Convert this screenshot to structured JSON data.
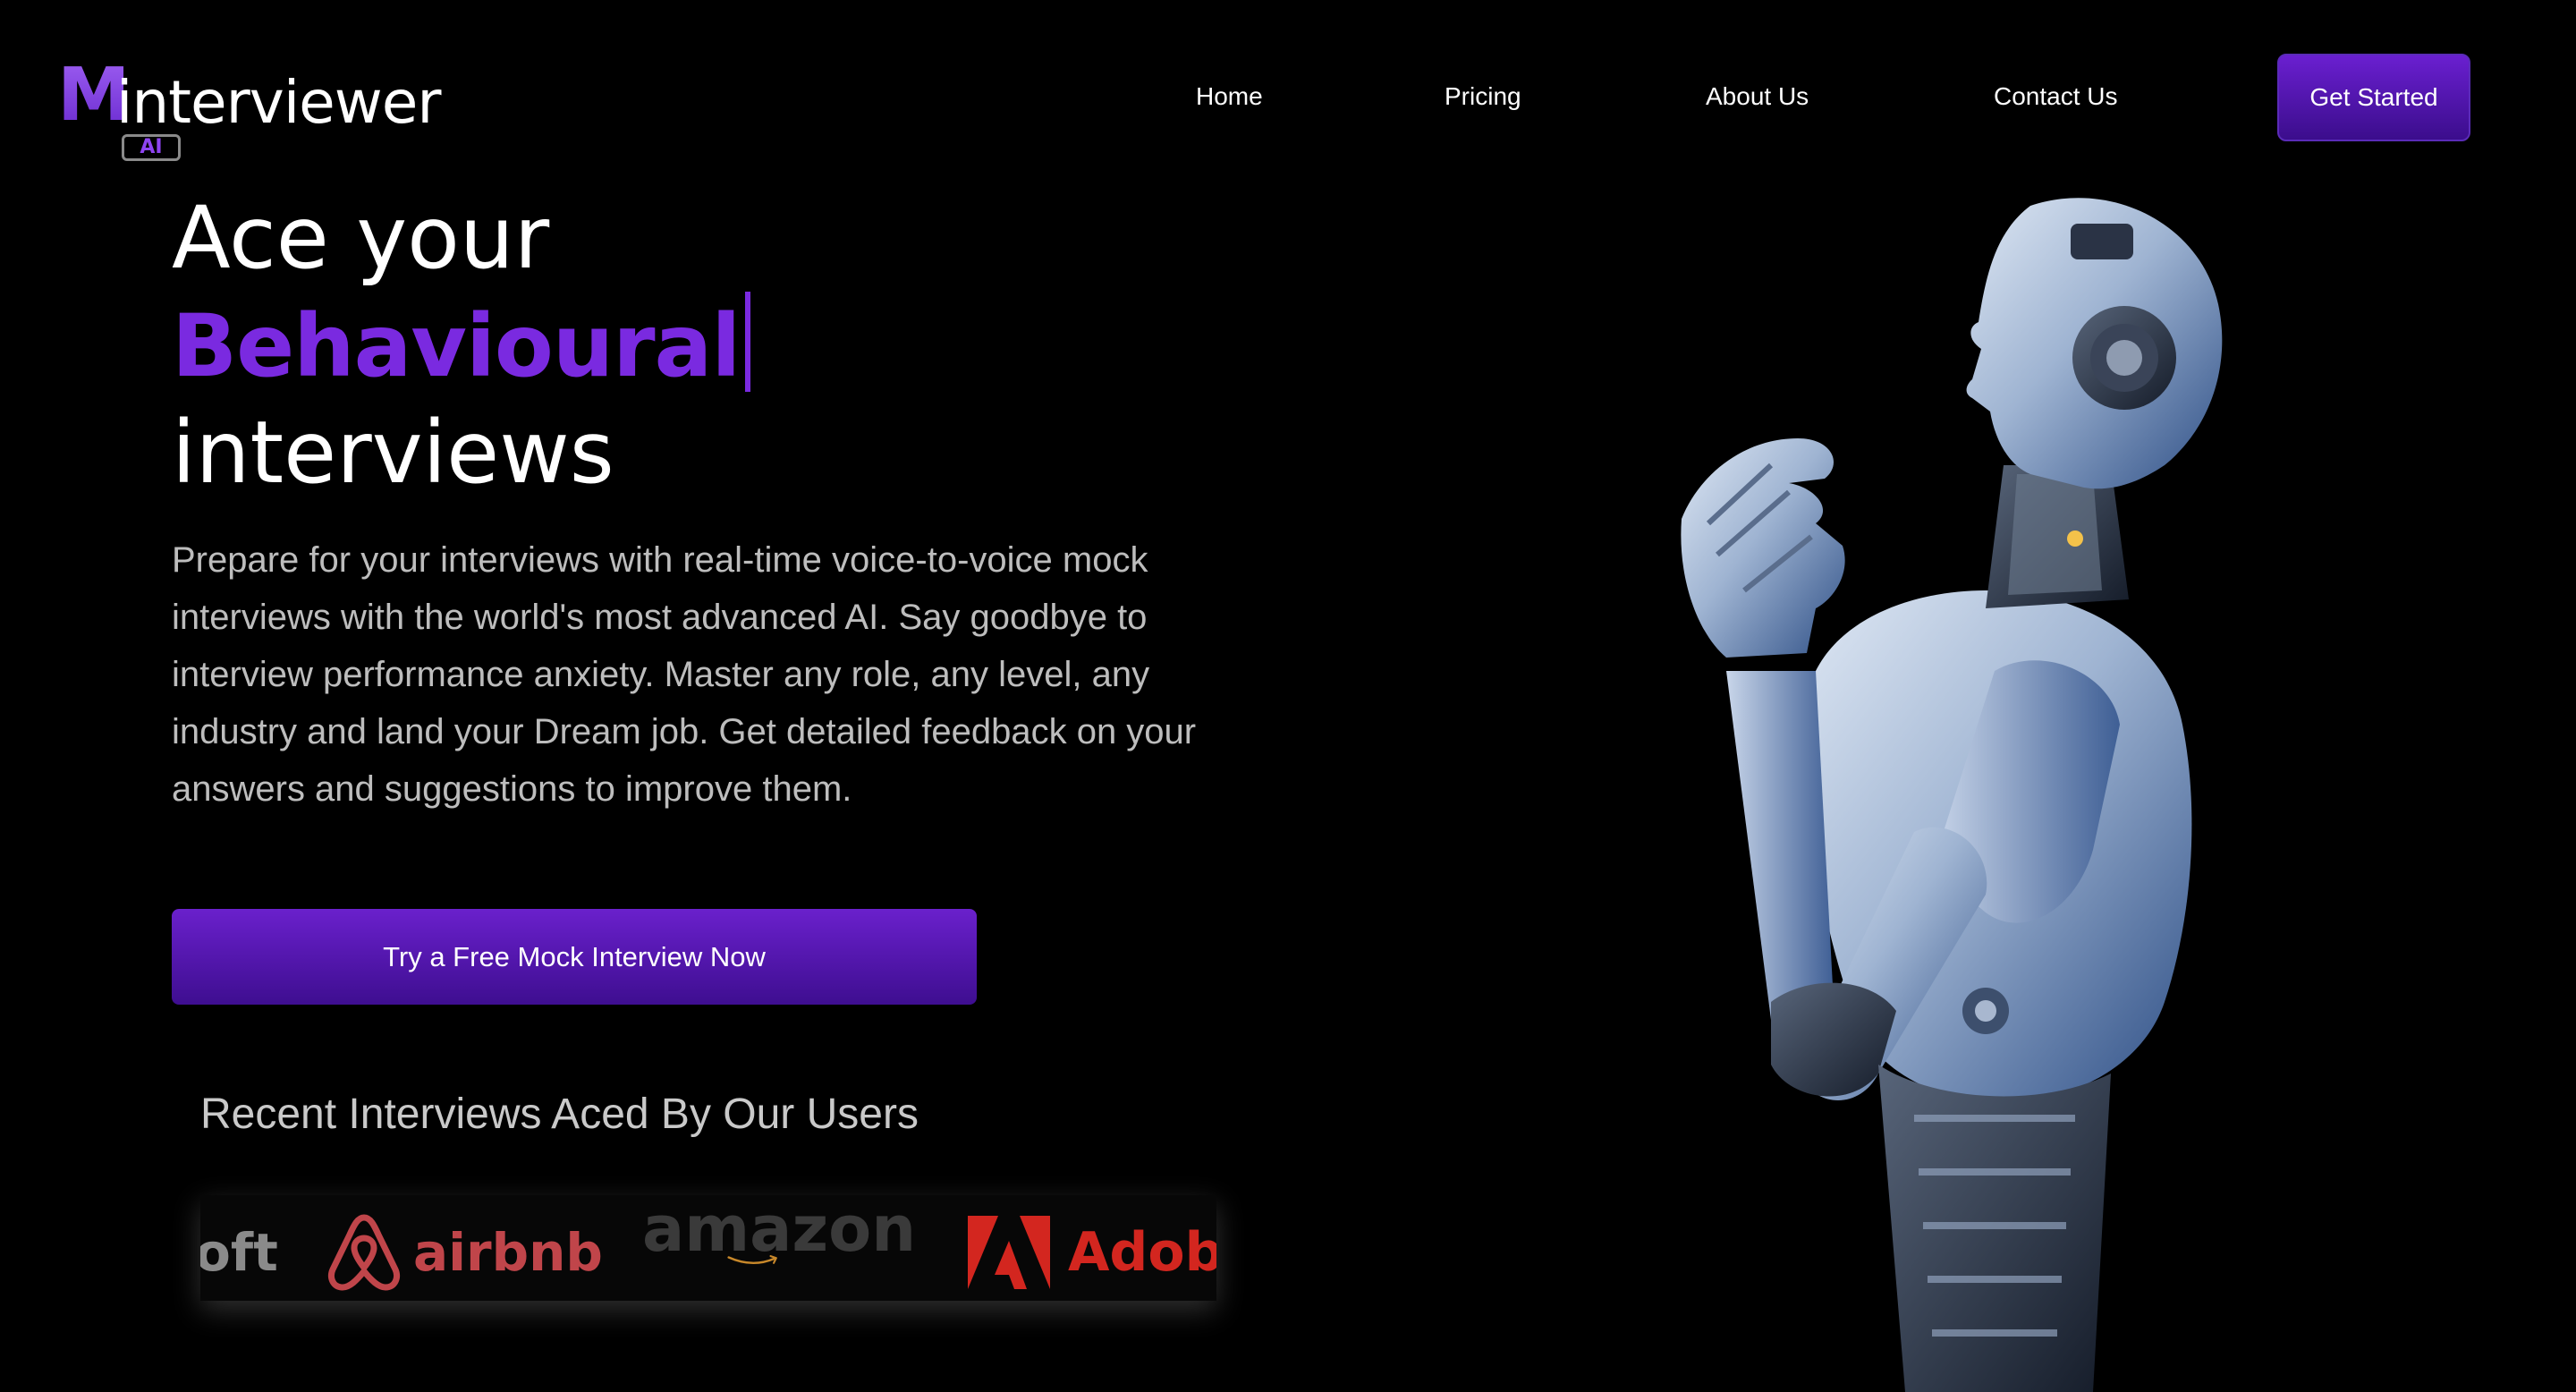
{
  "brand": {
    "logo_letter": "M",
    "logo_text": "interviewer",
    "logo_badge": "AI",
    "accent": "#7a2ae0"
  },
  "nav": {
    "items": [
      {
        "label": "Home"
      },
      {
        "label": "Pricing"
      },
      {
        "label": "About Us"
      },
      {
        "label": "Contact Us"
      }
    ],
    "cta": "Get Started"
  },
  "hero": {
    "line1": "Ace your",
    "highlight": "Behavioural",
    "line3": "interviews",
    "description": "Prepare for your interviews with real-time voice-to-voice mock interviews with the world's most advanced AI. Say goodbye to interview performance anxiety. Master any role, any level, any industry and land your Dream job. Get detailed feedback on your answers and suggestions to improve them.",
    "cta": "Try a Free Mock Interview Now"
  },
  "recent": {
    "title": "Recent Interviews Aced By Our Users",
    "companies": [
      {
        "name": "oft",
        "icon": "microsoft-partial-logo",
        "color": "#8a8a8a"
      },
      {
        "name": "airbnb",
        "icon": "airbnb-logo",
        "color": "#c0454a"
      },
      {
        "name": "amazon",
        "icon": "amazon-logo",
        "color": "#3a3a3a",
        "smile": "#c8882a"
      },
      {
        "name": "Adob",
        "icon": "adobe-logo",
        "color": "#d3261f"
      }
    ]
  },
  "image": {
    "icon": "robot-illustration"
  }
}
